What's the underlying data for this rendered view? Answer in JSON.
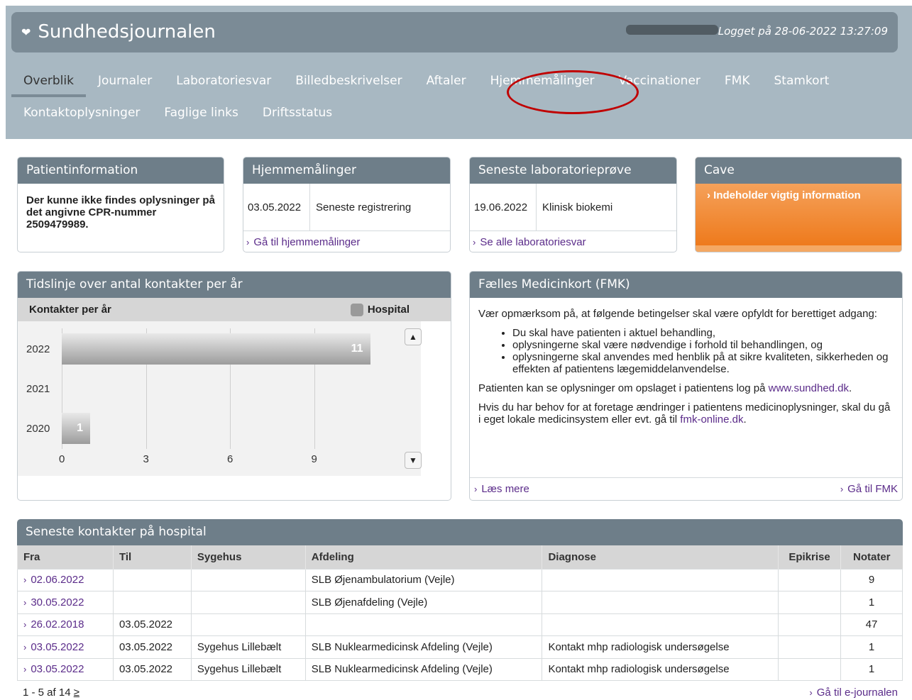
{
  "header": {
    "app_title": "Sundhedsjournalen",
    "login_text": "Logget på 28-06-2022 13:27:09"
  },
  "nav": {
    "row1": [
      "Overblik",
      "Journaler",
      "Laboratoriesvar",
      "Billedbeskrivelser",
      "Aftaler",
      "Hjemmemålinger",
      "Vaccinationer",
      "FMK",
      "Stamkort"
    ],
    "row2": [
      "Kontaktoplysninger",
      "Faglige links",
      "Driftsstatus"
    ]
  },
  "patient": {
    "title": "Patientinformation",
    "message": "Der kunne ikke findes oplysninger på det angivne CPR-nummer 2509479989."
  },
  "hjemmemaalinger": {
    "title": "Hjemmemålinger",
    "date": "03.05.2022",
    "label": "Seneste registrering",
    "link": "Gå til hjemmemålinger"
  },
  "lab": {
    "title": "Seneste laboratorieprøve",
    "date": "19.06.2022",
    "label": "Klinisk biokemi",
    "link": "Se alle laboratoriesvar"
  },
  "cave": {
    "title": "Cave",
    "text": "Indeholder vigtig information"
  },
  "timeline": {
    "title": "Tidslinje over antal kontakter per år",
    "header_label": "Kontakter per år",
    "legend": "Hospital"
  },
  "chart_data": {
    "type": "bar",
    "orientation": "horizontal",
    "categories": [
      "2022",
      "2021",
      "2020"
    ],
    "series": [
      {
        "name": "Hospital",
        "values": [
          11,
          0,
          1
        ]
      }
    ],
    "x_ticks": [
      "0",
      "3",
      "6",
      "9"
    ],
    "xlim": [
      0,
      12
    ]
  },
  "fmk": {
    "title": "Fælles Medicinkort (FMK)",
    "intro": "Vær opmærksom på, at følgende betingelser skal være opfyldt for berettiget adgang:",
    "bullets": [
      "Du skal have patienten i aktuel behandling,",
      "oplysningerne skal være nødvendige i forhold til behandlingen, og",
      "oplysningerne skal anvendes med henblik på at sikre kvaliteten, sikkerheden og effekten af patientens lægemiddelanvendelse."
    ],
    "log_text": "Patienten kan se oplysninger om opslaget i patientens log på ",
    "log_link": "www.sundhed.dk",
    "log_end": ".",
    "change_text": "Hvis du har behov for at foretage ændringer i patientens medicinoplysninger, skal du gå i eget lokale medicinsystem eller evt. gå til ",
    "change_link": "fmk-online.dk",
    "change_end": ".",
    "read_more": "Læs mere",
    "goto": "Gå til FMK"
  },
  "contacts": {
    "title": "Seneste kontakter på hospital",
    "columns": [
      "Fra",
      "Til",
      "Sygehus",
      "Afdeling",
      "Diagnose",
      "Epikrise",
      "Notater"
    ],
    "rows": [
      [
        "02.06.2022",
        "",
        "",
        "SLB Øjenambulatorium (Vejle)",
        "",
        "",
        "9"
      ],
      [
        "30.05.2022",
        "",
        "",
        "SLB Øjenafdeling (Vejle)",
        "",
        "",
        "1"
      ],
      [
        "26.02.2018",
        "03.05.2022",
        "",
        "",
        "",
        "",
        "47"
      ],
      [
        "03.05.2022",
        "03.05.2022",
        "Sygehus Lillebælt",
        "SLB Nuklearmedicinsk Afdeling (Vejle)",
        "Kontakt mhp radiologisk undersøgelse",
        "",
        "1"
      ],
      [
        "03.05.2022",
        "03.05.2022",
        "Sygehus Lillebælt",
        "SLB Nuklearmedicinsk Afdeling (Vejle)",
        "Kontakt mhp radiologisk undersøgelse",
        "",
        "1"
      ]
    ],
    "pager": "1 - 5 af 14",
    "pager_next": "≥",
    "goto": "Gå til e-journalen"
  }
}
